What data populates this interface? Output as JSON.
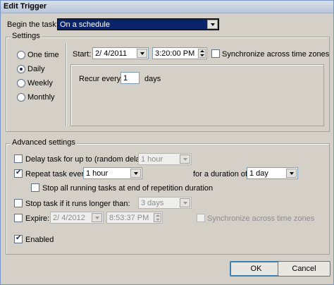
{
  "window": {
    "title": "Edit Trigger"
  },
  "begin": {
    "label": "Begin the task:",
    "value": "On a schedule"
  },
  "settings": {
    "title": "Settings",
    "radios": [
      {
        "label": "One time",
        "checked": false
      },
      {
        "label": "Daily",
        "checked": true
      },
      {
        "label": "Weekly",
        "checked": false
      },
      {
        "label": "Monthly",
        "checked": false
      }
    ],
    "start_label": "Start:",
    "start_date": "2/  4/2011",
    "start_time": "3:20:00 PM",
    "sync_label": "Synchronize across time zones",
    "recur_label": "Recur every:",
    "recur_value": "1",
    "recur_unit": "days"
  },
  "advanced": {
    "title": "Advanced settings",
    "delay_label": "Delay task for up to (random delay):",
    "delay_value": "1 hour",
    "repeat_label": "Repeat task every:",
    "repeat_value": "1 hour",
    "duration_label": "for a duration of:",
    "duration_value": "1 day",
    "stop_running_label": "Stop all running tasks at end of repetition duration",
    "stop_longer_label": "Stop task if it runs longer than:",
    "stop_longer_value": "3 days",
    "expire_label": "Expire:",
    "expire_date": "2/  4/2012",
    "expire_time": "8:53:37 PM",
    "expire_sync_label": "Synchronize across time zones",
    "enabled_label": "Enabled"
  },
  "buttons": {
    "ok": "OK",
    "cancel": "Cancel"
  }
}
